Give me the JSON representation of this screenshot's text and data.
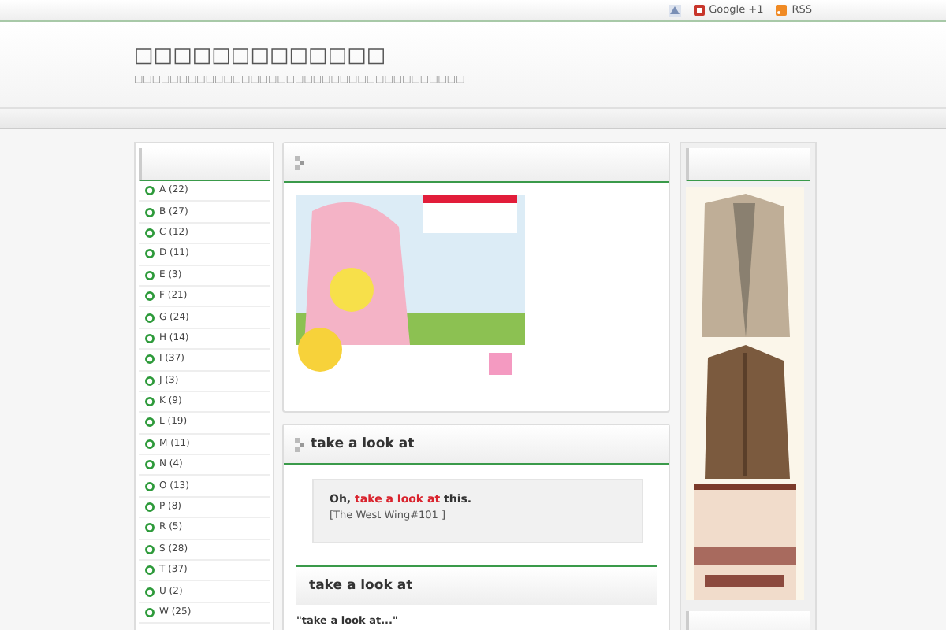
{
  "top_links": [
    {
      "kind": "share"
    },
    {
      "kind": "google",
      "label": "Google +1"
    },
    {
      "kind": "rss",
      "label": "RSS"
    }
  ],
  "site": {
    "title": "□□□□□□□□□□□□□",
    "tagline": "□□□□□□□□□□□□□□□□□□□□□□□□□□□□□□□□□□□□□"
  },
  "sidebar": {
    "items": [
      "A (22)",
      "B (27)",
      "C (12)",
      "D (11)",
      "E (3)",
      "F (21)",
      "G (24)",
      "H (14)",
      "I (37)",
      "J (3)",
      "K (9)",
      "L (19)",
      "M (11)",
      "N (4)",
      "O (13)",
      "P (8)",
      "R (5)",
      "S (28)",
      "T (37)",
      "U (2)",
      "W (25)"
    ]
  },
  "post": {
    "title": "take a look at",
    "quote": "Oh, **take a look at** this.",
    "source": "[The West Wing#101 ]",
    "section_title": "take a look at",
    "excerpt": "\"take a look at...\""
  }
}
